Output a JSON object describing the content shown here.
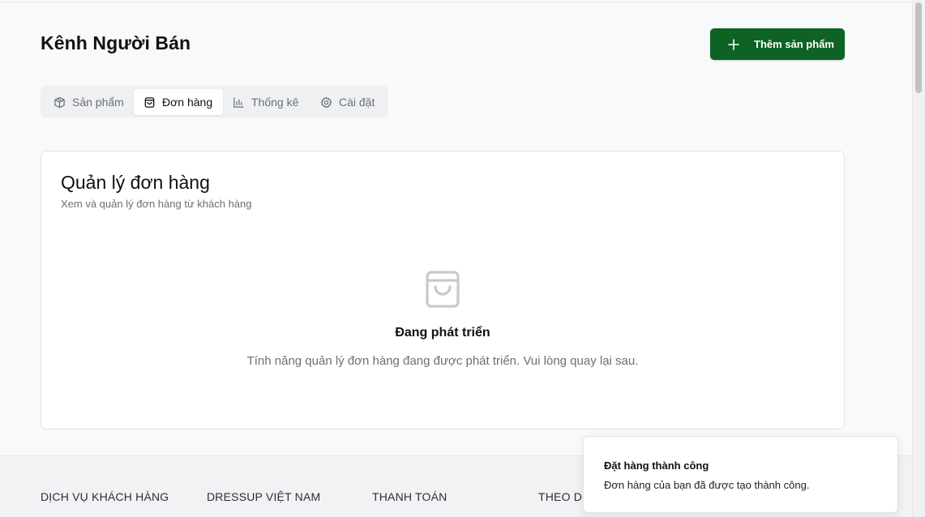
{
  "header": {
    "title": "Kênh Người Bán",
    "add_button_label": "Thêm sản phẩm"
  },
  "tabs": [
    {
      "label": "Sản phẩm",
      "icon": "package-icon",
      "active": false
    },
    {
      "label": "Đơn hàng",
      "icon": "shopping-bag-icon",
      "active": true
    },
    {
      "label": "Thống kê",
      "icon": "bar-chart-icon",
      "active": false
    },
    {
      "label": "Cài đặt",
      "icon": "gear-icon",
      "active": false
    }
  ],
  "orders_card": {
    "title": "Quản lý đơn hàng",
    "subtitle": "Xem và quản lý đơn hàng từ khách hàng",
    "empty_icon": "shopping-bag-icon",
    "empty_title": "Đang phát triển",
    "empty_description": "Tính năng quản lý đơn hàng đang được phát triển. Vui lòng quay lại sau."
  },
  "footer": {
    "columns": [
      "DỊCH VỤ KHÁCH HÀNG",
      "DRESSUP VIỆT NAM",
      "THANH TOÁN",
      "THEO DÕ"
    ]
  },
  "toast": {
    "title": "Đặt hàng thành công",
    "description": "Đơn hàng của bạn đã được tạo thành công."
  },
  "colors": {
    "primary": "#0e6224",
    "background": "#f8f9fa",
    "muted_text": "#6b6f76"
  }
}
